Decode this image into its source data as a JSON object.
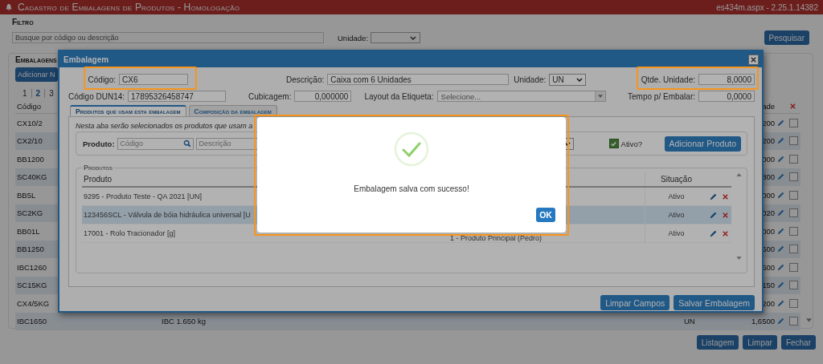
{
  "page": {
    "title": "Cadastro de Embalagens de Produtos  - Homologação",
    "version": "es434m.aspx - 2.25.1.14382",
    "filter": {
      "heading": "Filtro",
      "search_placeholder": "Busque por código ou descrição",
      "unit_label": "Unidade:",
      "search_button": "Pesquisar"
    },
    "packages": {
      "heading": "Embalagens",
      "add_button": "Adicionar N",
      "pages": [
        {
          "label": "1",
          "selected": false
        },
        {
          "label": "2",
          "selected": true
        },
        {
          "label": "3",
          "selected": false
        }
      ],
      "columns": [
        "Código",
        "ade"
      ],
      "rows": [
        {
          "code": "CX10/2",
          "value": "200",
          "checked": false
        },
        {
          "code": "CX2/10",
          "value": "200",
          "checked": false
        },
        {
          "code": "BB1200",
          "value": "000",
          "checked": false
        },
        {
          "code": "SC40KG",
          "value": "800",
          "checked": false
        },
        {
          "code": "BB5L",
          "value": "000",
          "checked": false
        },
        {
          "code": "SC2KG",
          "value": "020",
          "checked": false
        },
        {
          "code": "BB01L",
          "value": "000",
          "checked": false
        },
        {
          "code": "BB1250",
          "value": "500",
          "checked": false
        },
        {
          "code": "IBC1260",
          "value": "500",
          "checked": false
        },
        {
          "code": "SC15KG",
          "value": "150",
          "checked": false
        },
        {
          "code": "CX4/5KG",
          "value": "200",
          "checked": false
        },
        {
          "code": "IBC1650",
          "description": "IBC 1.650 kg",
          "unit": "UN",
          "value": "1,6500",
          "checked": false
        }
      ]
    },
    "buttons": [
      "Listagem",
      "Limpar",
      "Fechar"
    ]
  },
  "modal": {
    "title": "Embalagem",
    "field_rows": [
      [
        {
          "label": "Código:",
          "value": "CX6",
          "kind": "input"
        },
        {
          "label": "Descrição:",
          "value": "Caixa com 6 Unidades",
          "kind": "input"
        },
        {
          "label": "Unidade:",
          "value": "UN",
          "kind": "select"
        },
        {
          "label": "Qtde. Unidade:",
          "value": "8,0000",
          "kind": "number"
        }
      ],
      [
        {
          "label": "Código DUN14:",
          "value": "17895326458747",
          "kind": "input"
        },
        {
          "label": "Cubicagem:",
          "value": "0,000000",
          "kind": "number"
        },
        {
          "label": "Layout da Etiqueta:",
          "placeholder": "Selecione...",
          "kind": "combo"
        },
        {
          "label": "Tempo p/ Embalar:",
          "value": "0,0000",
          "kind": "number"
        }
      ]
    ],
    "tabs": [
      {
        "label": "Produtos que usam esta embalagem",
        "selected": true
      },
      {
        "label": "Composição da embalagem",
        "selected": false
      }
    ],
    "tab_note": "Nesta aba serão selecionados os produtos que usam a",
    "product_filter": {
      "label": "Produto:",
      "code_placeholder": "Código",
      "description_placeholder": "Descrição",
      "active_label": "Ativo?",
      "active_checked": true,
      "add_button": "Adicionar Produto"
    },
    "products": {
      "legend": "Produtos",
      "columns": [
        "Produto",
        "Situação"
      ],
      "rows": [
        {
          "product": "9295 - Produto Teste - QA 2021 [UN]",
          "status": "Ativo",
          "selected": false
        },
        {
          "product": "123456SCL - Válvula de bóia hidráulica universal [U",
          "status": "Ativo",
          "selected": true
        },
        {
          "product": "17001 - Rolo Tracionador [g]",
          "column_2": "1 - Produto Principal (Pedro)",
          "status": "Ativo",
          "selected": false
        }
      ]
    },
    "footer_buttons": [
      "Limpar Campos",
      "Salvar Embalagem"
    ]
  },
  "dialog": {
    "message": "Embalagem salva com sucesso!",
    "button": "OK"
  }
}
